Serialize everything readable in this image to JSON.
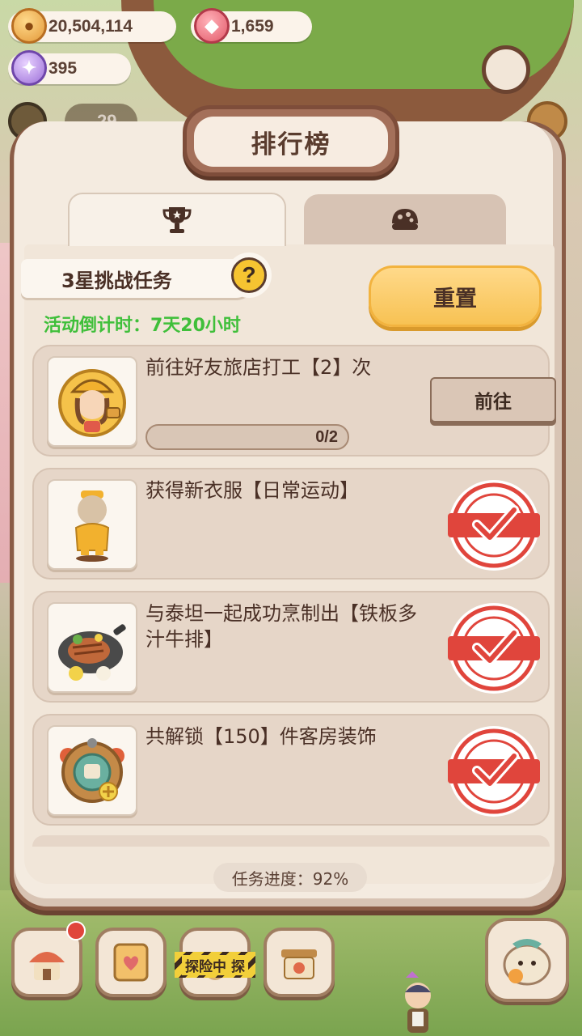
{
  "currencies": {
    "coins": "20,504,114",
    "gems": "1,659",
    "crystals": "395"
  },
  "background": {
    "counter": "29"
  },
  "panel": {
    "title": "排行榜",
    "tabs": [
      {
        "icon": "trophy-icon",
        "active": true
      },
      {
        "icon": "mushroom-icon",
        "active": false
      }
    ]
  },
  "challenge": {
    "label": "3星挑战任务",
    "help": "?",
    "reset_label": "重置",
    "countdown": "活动倒计时：7天20小时"
  },
  "tasks": [
    {
      "text": "前往好友旅店打工【2】次",
      "progress": "0/2",
      "progress_fraction": 0,
      "action_label": "前往",
      "completed": false,
      "icon": "worker-icon"
    },
    {
      "text": "获得新衣服【日常运动】",
      "completed": true,
      "icon": "outfit-icon"
    },
    {
      "text": "与泰坦一起成功烹制出【铁板多汁牛排】",
      "completed": true,
      "icon": "steak-icon"
    },
    {
      "text": "共解锁【150】件客房装饰",
      "completed": true,
      "icon": "decoration-icon"
    }
  ],
  "footer": {
    "progress_text": "任务进度：92%"
  },
  "bottom_bar": {
    "explore_label": "探险中 探",
    "notification": true
  },
  "colors": {
    "panel_border": "#8a5c46",
    "reset_button": "#f7c253",
    "countdown_green": "#3fbf3a",
    "stamp_red": "#e0453c"
  }
}
